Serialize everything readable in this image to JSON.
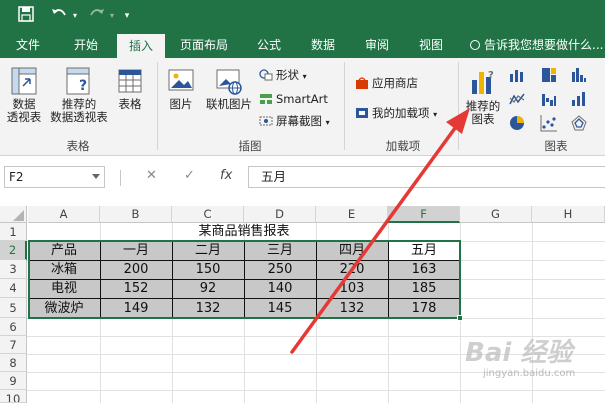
{
  "titlebar": {
    "quick_access": [
      "save-icon",
      "undo-icon",
      "redo-icon",
      "customize-icon"
    ]
  },
  "tabs": [
    {
      "label": "文件"
    },
    {
      "label": "开始"
    },
    {
      "label": "插入",
      "active": true
    },
    {
      "label": "页面布局"
    },
    {
      "label": "公式"
    },
    {
      "label": "数据"
    },
    {
      "label": "审阅"
    },
    {
      "label": "视图"
    }
  ],
  "tellme": "告诉我您想要做什么...",
  "ribbon": {
    "tables": {
      "pivot": "数据\n透视表",
      "recommended_pivot": "推荐的\n数据透视表",
      "table": "表格",
      "group": "表格"
    },
    "illustrations": {
      "picture": "图片",
      "online_picture": "联机图片",
      "shapes": "形状",
      "smartart": "SmartArt",
      "screenshot": "屏幕截图",
      "group": "插图"
    },
    "addins": {
      "store": "应用商店",
      "my_addins": "我的加载项",
      "group": "加载项"
    },
    "charts": {
      "recommended": "推荐的\n图表",
      "group": "图表"
    }
  },
  "formula_bar": {
    "name_box": "F2",
    "cancel": "✕",
    "enter": "✓",
    "fx": "fx",
    "content": "五月"
  },
  "sheet": {
    "columns": [
      "A",
      "B",
      "C",
      "D",
      "E",
      "F",
      "G",
      "H"
    ],
    "selected_column": "F",
    "rows": [
      "1",
      "2",
      "3",
      "4",
      "5",
      "6",
      "7",
      "8",
      "9",
      "10"
    ],
    "selected_row": "2",
    "title": "某商品销售报表",
    "header": [
      "产品",
      "一月",
      "二月",
      "三月",
      "四月",
      "五月"
    ],
    "data": [
      [
        "冰箱",
        "200",
        "150",
        "250",
        "220",
        "163"
      ],
      [
        "电视",
        "152",
        "92",
        "140",
        "103",
        "185"
      ],
      [
        "微波炉",
        "149",
        "132",
        "145",
        "132",
        "178"
      ]
    ]
  },
  "watermark": {
    "main": "Bai 经验",
    "sub": "jingyan.baidu.com"
  },
  "colors": {
    "excel_green": "#217346",
    "arrow_red": "#e53935"
  }
}
